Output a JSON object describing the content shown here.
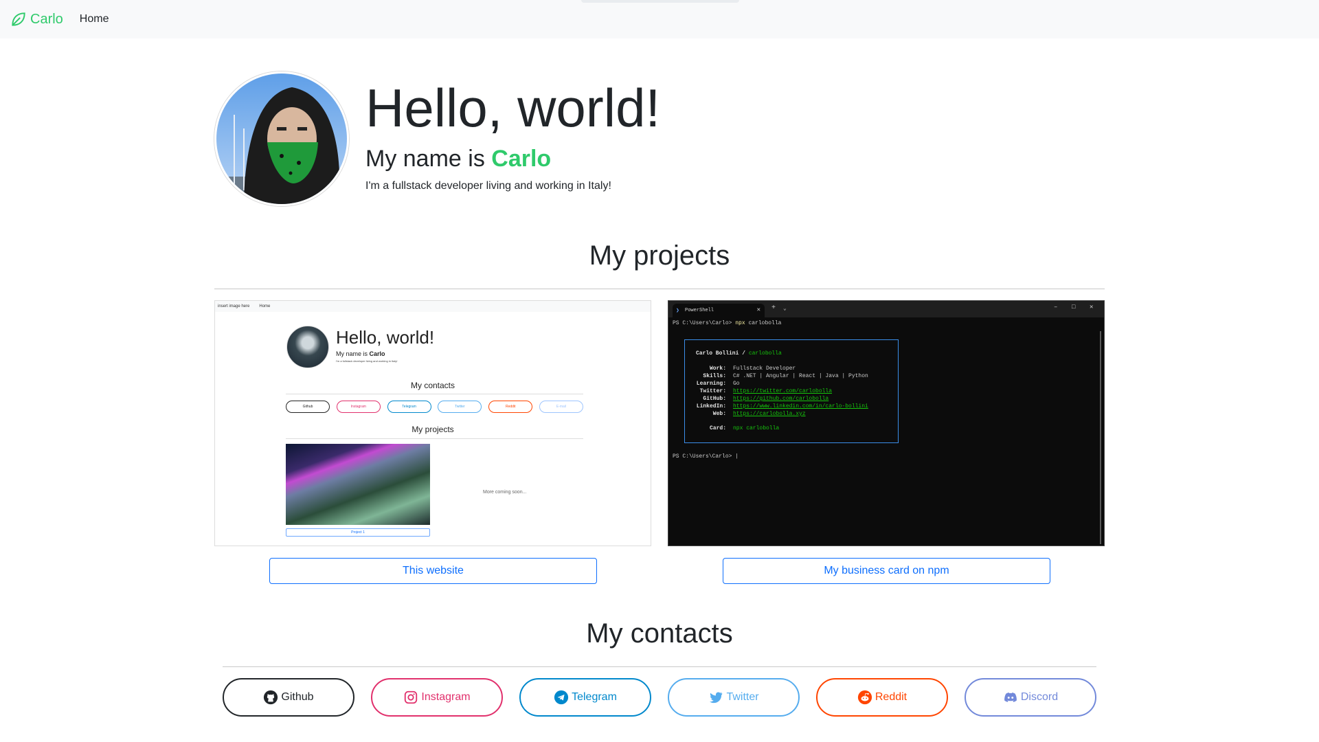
{
  "navbar": {
    "brand": "Carlo",
    "links": [
      "Home"
    ]
  },
  "hero": {
    "title": "Hello, world!",
    "name_prefix": "My name is ",
    "name": "Carlo",
    "description": "I'm a fullstack developer living and working in Italy!"
  },
  "projects": {
    "heading": "My projects",
    "items": [
      {
        "button": "This website"
      },
      {
        "button": "My business card on npm"
      }
    ]
  },
  "mini_site": {
    "nav_brand": "insert image here",
    "nav_link": "Home",
    "title": "Hello, world!",
    "name_prefix": "My name is ",
    "name": "Carlo",
    "description": "I'm a fullstack developer living and working in Italy!",
    "contacts_heading": "My contacts",
    "contacts": [
      "Github",
      "Instagram",
      "Telegram",
      "Twitter",
      "Reddit",
      "E-mail"
    ],
    "projects_heading": "My projects",
    "project_button": "Project 1",
    "more": "More coming soon..."
  },
  "terminal": {
    "tab_title": "PowerShell",
    "prompt": "PS C:\\Users\\Carlo>",
    "command": "npx",
    "command_arg": "carlobolla",
    "card_name": "Carlo Bollini /",
    "card_handle": "carlobolla",
    "rows": [
      {
        "key": "Work:",
        "value": "Fullstack Developer"
      },
      {
        "key": "Skills:",
        "value": "C# .NET | Angular | React | Java | Python"
      },
      {
        "key": "Learning:",
        "value": "Go"
      },
      {
        "key": "Twitter:",
        "link": "https://twitter.com/carlobolla"
      },
      {
        "key": "GitHub:",
        "link": "https://github.com/carlobolla"
      },
      {
        "key": "LinkedIn:",
        "link": "https://www.linkedin.com/in/carlo-bollini"
      },
      {
        "key": "Web:",
        "link": "https://carlobolla.xyz"
      }
    ],
    "card_key": "Card:",
    "card_value": "npx carlobolla",
    "prompt2": "PS C:\\Users\\Carlo> |"
  },
  "contacts": {
    "heading": "My contacts",
    "items": [
      {
        "label": "Github",
        "color": "#212529",
        "icon": "github-icon"
      },
      {
        "label": "Instagram",
        "color": "#e1306c",
        "icon": "instagram-icon"
      },
      {
        "label": "Telegram",
        "color": "#0088cc",
        "icon": "telegram-icon"
      },
      {
        "label": "Twitter",
        "color": "#55acee",
        "icon": "twitter-icon"
      },
      {
        "label": "Reddit",
        "color": "#ff4500",
        "icon": "reddit-icon"
      },
      {
        "label": "Discord",
        "color": "#7289da",
        "icon": "discord-icon"
      }
    ]
  },
  "colors": {
    "accent": "#2fca6b",
    "primary": "#0d6efd"
  }
}
